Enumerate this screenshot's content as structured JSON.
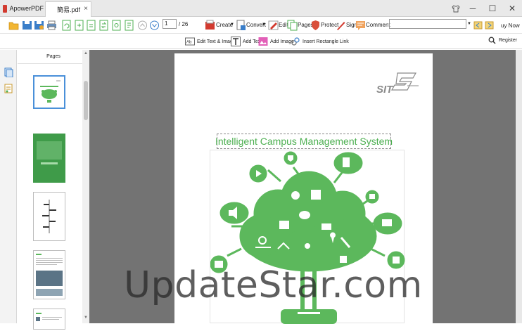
{
  "window": {
    "app_name": "ApowerPDF",
    "doc_tab": "簡易.pdf",
    "tab_close": "×",
    "controls": {
      "minimize": "─",
      "maximize": "☐",
      "close": "✕"
    }
  },
  "toolbar": {
    "page_current": "1",
    "page_total": "/ 26",
    "create_label": "Create",
    "convert_label": "Convert",
    "edit_label": "Edit",
    "pages_label": "Pages",
    "protect_label": "Protect",
    "sign_label": "Sign",
    "comment_label": "Comment",
    "search_placeholder": "",
    "buy_now": "uy Now"
  },
  "subtoolbar": {
    "edit_text_images": "Edit Text & Images",
    "add_text": "Add Text",
    "add_image": "Add Image",
    "insert_rect_link": "Insert Rectangle Link",
    "register": "Register"
  },
  "pages_panel": {
    "header": "Pages"
  },
  "document": {
    "title": "Intelligent Campus Management System",
    "logo_text": "SIT"
  },
  "watermark": "UpdateStar.com",
  "colors": {
    "accent_green": "#5cb85c",
    "canvas_gray": "#737373",
    "selection_blue": "#4a90d9"
  }
}
